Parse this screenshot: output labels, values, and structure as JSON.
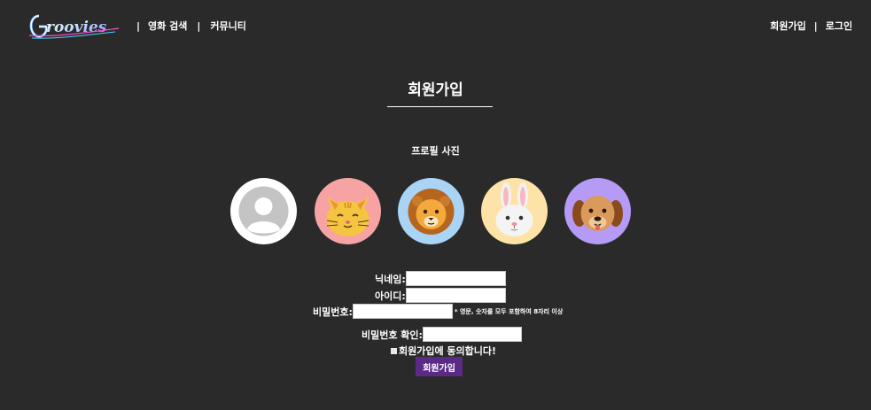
{
  "header": {
    "logo_text": "Groovies",
    "nav_left": [
      {
        "label": "영화 검색"
      },
      {
        "label": "커뮤니티"
      }
    ],
    "nav_right": [
      {
        "label": "회원가입"
      },
      {
        "label": "로그인"
      }
    ],
    "separator": "|"
  },
  "page": {
    "title": "회원가입",
    "profile_label": "프로필 사진"
  },
  "avatars": [
    {
      "name": "default-avatar-icon",
      "bg": "#ffffff"
    },
    {
      "name": "cat-icon",
      "bg": "#f7a3a3"
    },
    {
      "name": "lion-icon",
      "bg": "#a9d4f5"
    },
    {
      "name": "rabbit-icon",
      "bg": "#fde3a7"
    },
    {
      "name": "dog-icon",
      "bg": "#b59bf5"
    }
  ],
  "form": {
    "nickname_label": "닉네임:",
    "nickname_value": "",
    "id_label": "아이디:",
    "id_value": "",
    "password_label": "비밀번호:",
    "password_value": "",
    "password_hint": "* 영문, 숫자를 모두 포함하여 8자리 이상",
    "password_confirm_label": "비밀번호 확인:",
    "password_confirm_value": "",
    "agree_label": "회원가입에 동의합니다!",
    "submit_label": "회원가입"
  },
  "colors": {
    "background": "#2a2a2a",
    "submit_button": "#5b2a86",
    "text": "#ffffff"
  }
}
